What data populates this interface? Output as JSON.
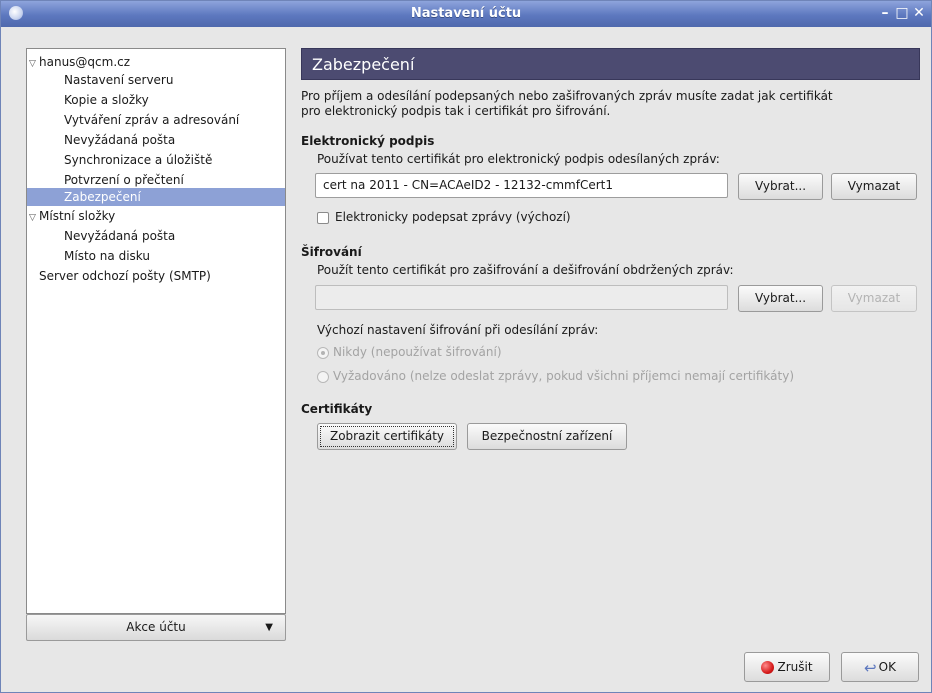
{
  "window": {
    "title": "Nastavení účtu"
  },
  "tree": {
    "account": "hanus@qcm.cz",
    "account_items": [
      "Nastavení serveru",
      "Kopie a složky",
      "Vytváření zpráv a adresování",
      "Nevyžádaná pošta",
      "Synchronizace a úložiště",
      "Potvrzení o přečtení",
      "Zabezpečení"
    ],
    "local": "Místní složky",
    "local_items": [
      "Nevyžádaná pošta",
      "Místo na disku"
    ],
    "smtp": "Server odchozí pošty (SMTP)"
  },
  "account_actions": {
    "label": "Akce účtu"
  },
  "page": {
    "title": "Zabezpečení",
    "intro_line1": "Pro příjem a odesílání podepsaných nebo zašifrovaných zpráv musíte zadat jak certifikát",
    "intro_line2": "pro elektronický podpis tak i certifikát pro šifrování."
  },
  "signing": {
    "heading": "Elektronický podpis",
    "label": "Používat tento certifikát pro elektronický podpis odesílaných zpráv:",
    "value": "cert na 2011 - CN=ACAeID2 - 12132-cmmfCert1",
    "select_button": "Vybrat...",
    "clear_button": "Vymazat",
    "checkbox_label": "Elektronicky podepsat zprávy (výchozí)"
  },
  "encryption": {
    "heading": "Šifrování",
    "label": "Použít tento certifikát pro zašifrování a dešifrování obdržených zpráv:",
    "value": "",
    "select_button": "Vybrat...",
    "clear_button": "Vymazat",
    "default_label": "Výchozí nastavení šifrování při odesílání zpráv:",
    "radio_never": "Nikdy (nepoužívat šifrování)",
    "radio_required": "Vyžadováno (nelze odeslat zprávy, pokud všichni příjemci nemají certifikáty)"
  },
  "certificates": {
    "heading": "Certifikáty",
    "view_button": "Zobrazit certifikáty",
    "devices_button": "Bezpečnostní zařízení"
  },
  "footer": {
    "cancel_button": "Zrušit",
    "ok_button": "OK"
  }
}
